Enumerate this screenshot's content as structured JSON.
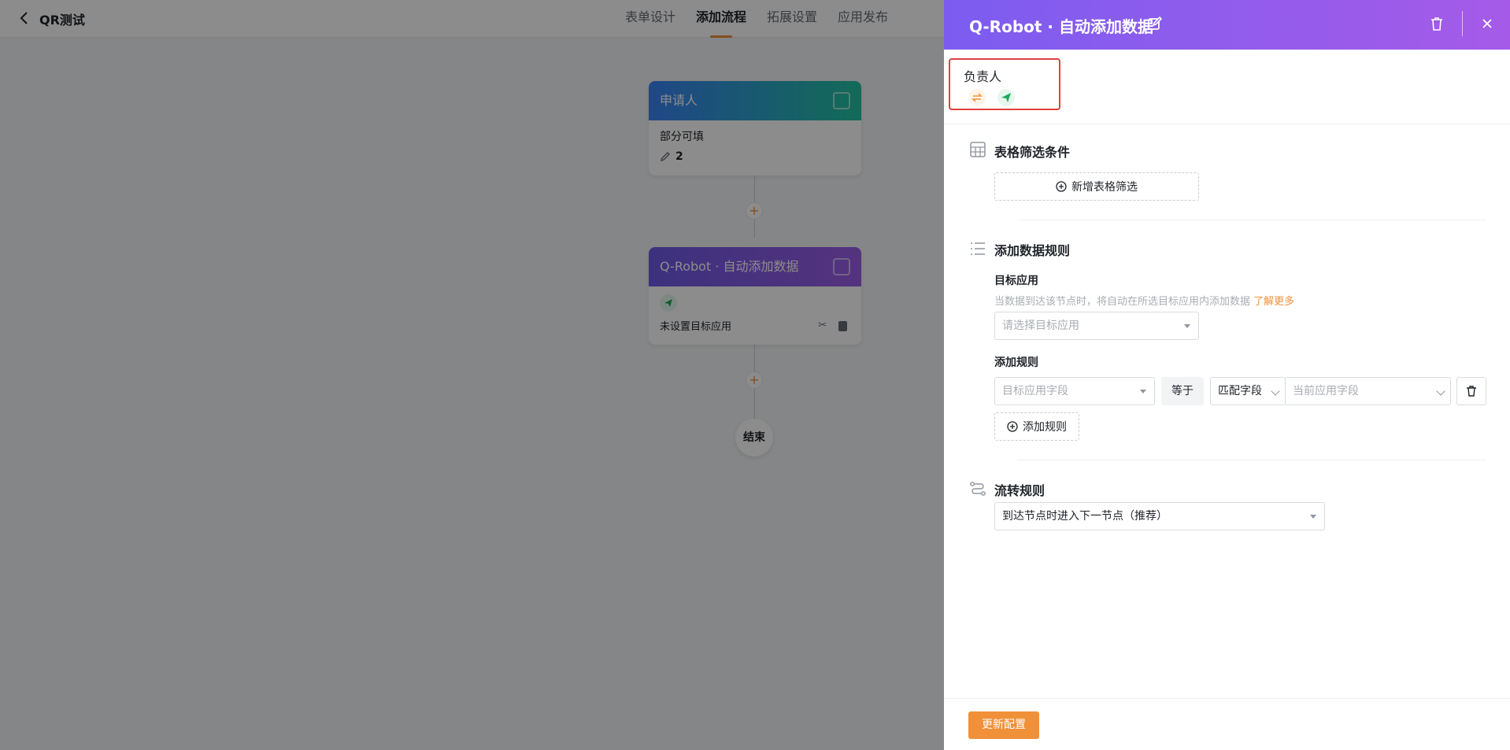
{
  "app": {
    "title": "QR测试",
    "tabs": [
      {
        "label": "表单设计",
        "active": false
      },
      {
        "label": "添加流程",
        "active": true
      },
      {
        "label": "拓展设置",
        "active": false
      },
      {
        "label": "应用发布",
        "active": false
      }
    ]
  },
  "flow": {
    "node1": {
      "title": "申请人",
      "subtitle": "部分可填",
      "count": "2"
    },
    "node2": {
      "title": "Q-Robot · 自动添加数据",
      "status": "未设置目标应用"
    },
    "end_label": "结束"
  },
  "drawer": {
    "title": "Q-Robot · 自动添加数据",
    "assignee_label": "负责人",
    "table_filter": {
      "title": "表格筛选条件",
      "add_button": "新增表格筛选"
    },
    "add_data_rules": {
      "title": "添加数据规则",
      "target_app_label": "目标应用",
      "hint": "当数据到达该节点时，将自动在所选目标应用内添加数据",
      "learn_more": "了解更多",
      "target_app_placeholder": "请选择目标应用",
      "rules_label": "添加规则",
      "target_field_placeholder": "目标应用字段",
      "operator": "等于",
      "match_mode": "匹配字段",
      "current_field_placeholder": "当前应用字段",
      "add_rule_button": "添加规则"
    },
    "transfer_rules": {
      "title": "流转规则",
      "selected": "到达节点时进入下一节点（推荐）"
    },
    "update_button": "更新配置"
  },
  "colors": {
    "accent": "#f0913a",
    "drawer_header_start": "#7c5cf0",
    "drawer_header_end": "#a55be8",
    "highlight_box": "#e0413f"
  }
}
